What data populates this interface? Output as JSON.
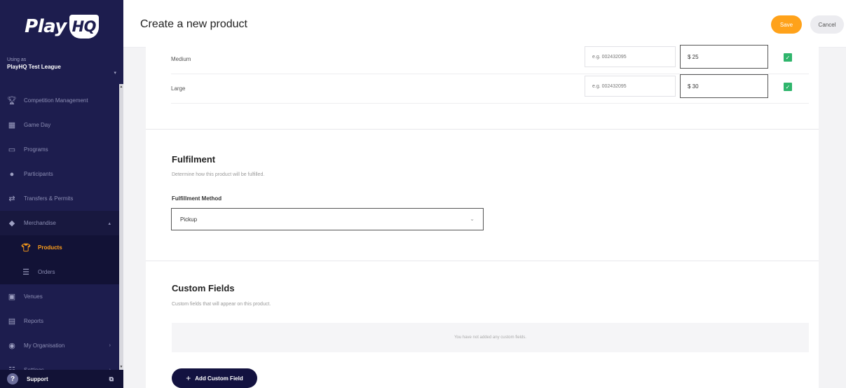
{
  "app": {
    "logo_text": "Play",
    "logo_badge": "HQ"
  },
  "org_switcher": {
    "using_as": "Using as",
    "org_name": "PlayHQ Test League"
  },
  "sidebar": {
    "items": [
      {
        "label": "Competition Management",
        "icon": "trophy-icon"
      },
      {
        "label": "Game Day",
        "icon": "scoreboard-icon"
      },
      {
        "label": "Programs",
        "icon": "book-icon"
      },
      {
        "label": "Participants",
        "icon": "people-icon"
      },
      {
        "label": "Transfers & Permits",
        "icon": "transfer-arrows-icon"
      },
      {
        "label": "Merchandise",
        "icon": "merchandise-icon"
      },
      {
        "label": "Products",
        "icon": "shirt-icon"
      },
      {
        "label": "Orders",
        "icon": "list-icon"
      },
      {
        "label": "Venues",
        "icon": "venue-icon"
      },
      {
        "label": "Reports",
        "icon": "reports-icon"
      },
      {
        "label": "My Organisation",
        "icon": "organisation-icon"
      },
      {
        "label": "Settings",
        "icon": "settings-sliders-icon"
      }
    ],
    "support_label": "Support"
  },
  "header": {
    "title": "Create a new product",
    "save_label": "Save",
    "cancel_label": "Cancel"
  },
  "variants": [
    {
      "name": "Medium",
      "sku_placeholder": "e.g. 002432095",
      "price": "$ 25",
      "enabled": true
    },
    {
      "name": "Large",
      "sku_placeholder": "e.g. 002432095",
      "price": "$ 30",
      "enabled": true
    }
  ],
  "fulfilment": {
    "title": "Fulfilment",
    "description": "Determine how this product will be fulfilled.",
    "method_label": "Fulfillment Method",
    "method_value": "Pickup"
  },
  "custom_fields": {
    "title": "Custom Fields",
    "description": "Custom fields that will appear on this product.",
    "empty_message": "You have not added any custom fields.",
    "add_label": "Add Custom Field"
  }
}
